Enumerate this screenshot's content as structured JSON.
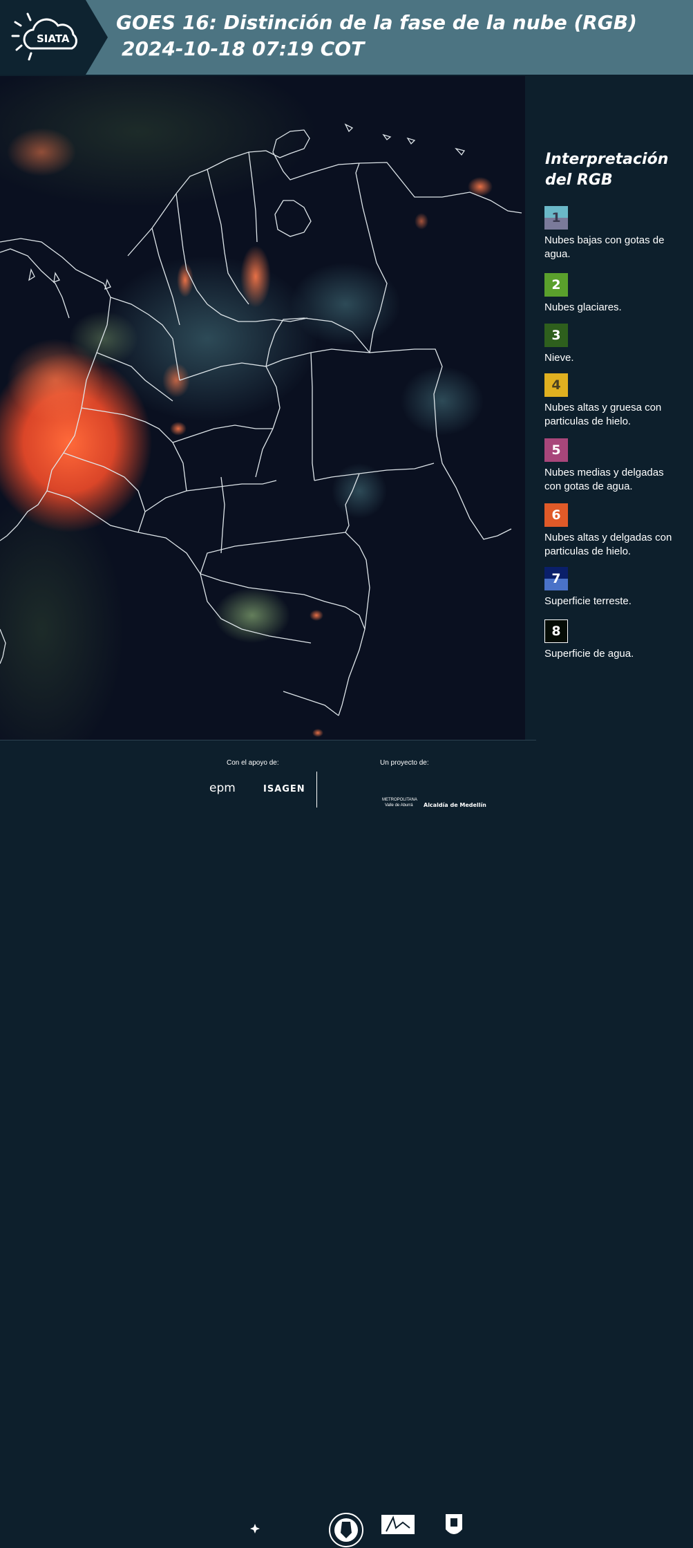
{
  "header": {
    "logo_text": "SIATA",
    "title_line1": "GOES 16: Distinción de la fase de la nube (RGB)",
    "title_line2": "2024-10-18 07:19 COT"
  },
  "legend": {
    "title": "Interpretación del RGB",
    "items": [
      {
        "num": "1",
        "label": "Nubes bajas con gotas de agua.",
        "top_color": "#6ab8c8",
        "bottom_color": "#7a7a9a"
      },
      {
        "num": "2",
        "label": "Nubes glaciares.",
        "color": "#5aa02c"
      },
      {
        "num": "3",
        "label": "Nieve.",
        "color": "#2e5f1d"
      },
      {
        "num": "4",
        "label": "Nubes altas y gruesa con particulas de hielo.",
        "color": "#e0b020"
      },
      {
        "num": "5",
        "label": "Nubes medias y delgadas con gotas de agua.",
        "color": "#a8467a"
      },
      {
        "num": "6",
        "label": "Nubes altas y delgadas con particulas de hielo.",
        "color": "#e05a28"
      },
      {
        "num": "7",
        "label": "Superficie terreste.",
        "top_color": "#0a1f6a",
        "bottom_color": "#4a72c8"
      },
      {
        "num": "8",
        "label": "Superficie de agua.",
        "color": "#050c05"
      }
    ]
  },
  "footer": {
    "support_label": "Con el apoyo de:",
    "project_label": "Un proyecto de:",
    "logos": [
      "epm",
      "ISAGEN",
      "METROPOLITANA",
      "Valle de Aburrá",
      "Alcaldía de Medellín"
    ]
  }
}
